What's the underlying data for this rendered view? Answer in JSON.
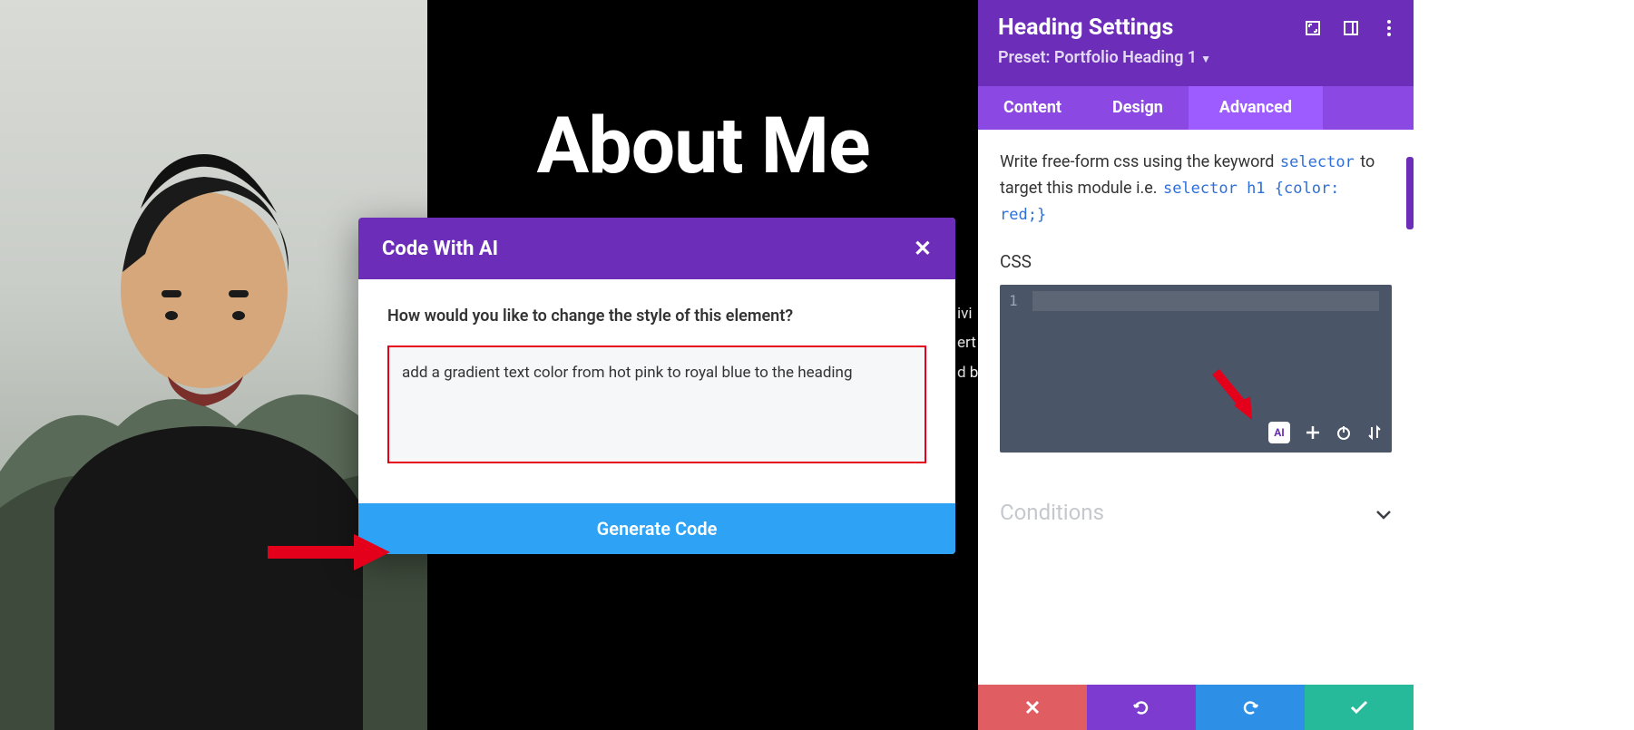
{
  "canvas": {
    "heading": "About Me",
    "body_lines": "ivi\nert\nd b"
  },
  "ai_modal": {
    "title": "Code With AI",
    "close_glyph": "✕",
    "question": "How would you like to change the style of this element?",
    "input_value": "add a gradient text color from hot pink to royal blue to the heading",
    "generate_label": "Generate Code"
  },
  "panel": {
    "title": "Heading Settings",
    "preset_prefix": "Preset: ",
    "preset_name": "Portfolio Heading 1",
    "tabs": {
      "content": "Content",
      "design": "Design",
      "advanced": "Advanced"
    },
    "hint_pre": "Write free-form css using the keyword ",
    "hint_code1": "selector",
    "hint_mid": " to target this module i.e. ",
    "hint_code2": "selector h1 {color: red;}",
    "css_label": "CSS",
    "editor_line1": "1",
    "ai_icon_label": "AI",
    "conditions_label": "Conditions"
  }
}
